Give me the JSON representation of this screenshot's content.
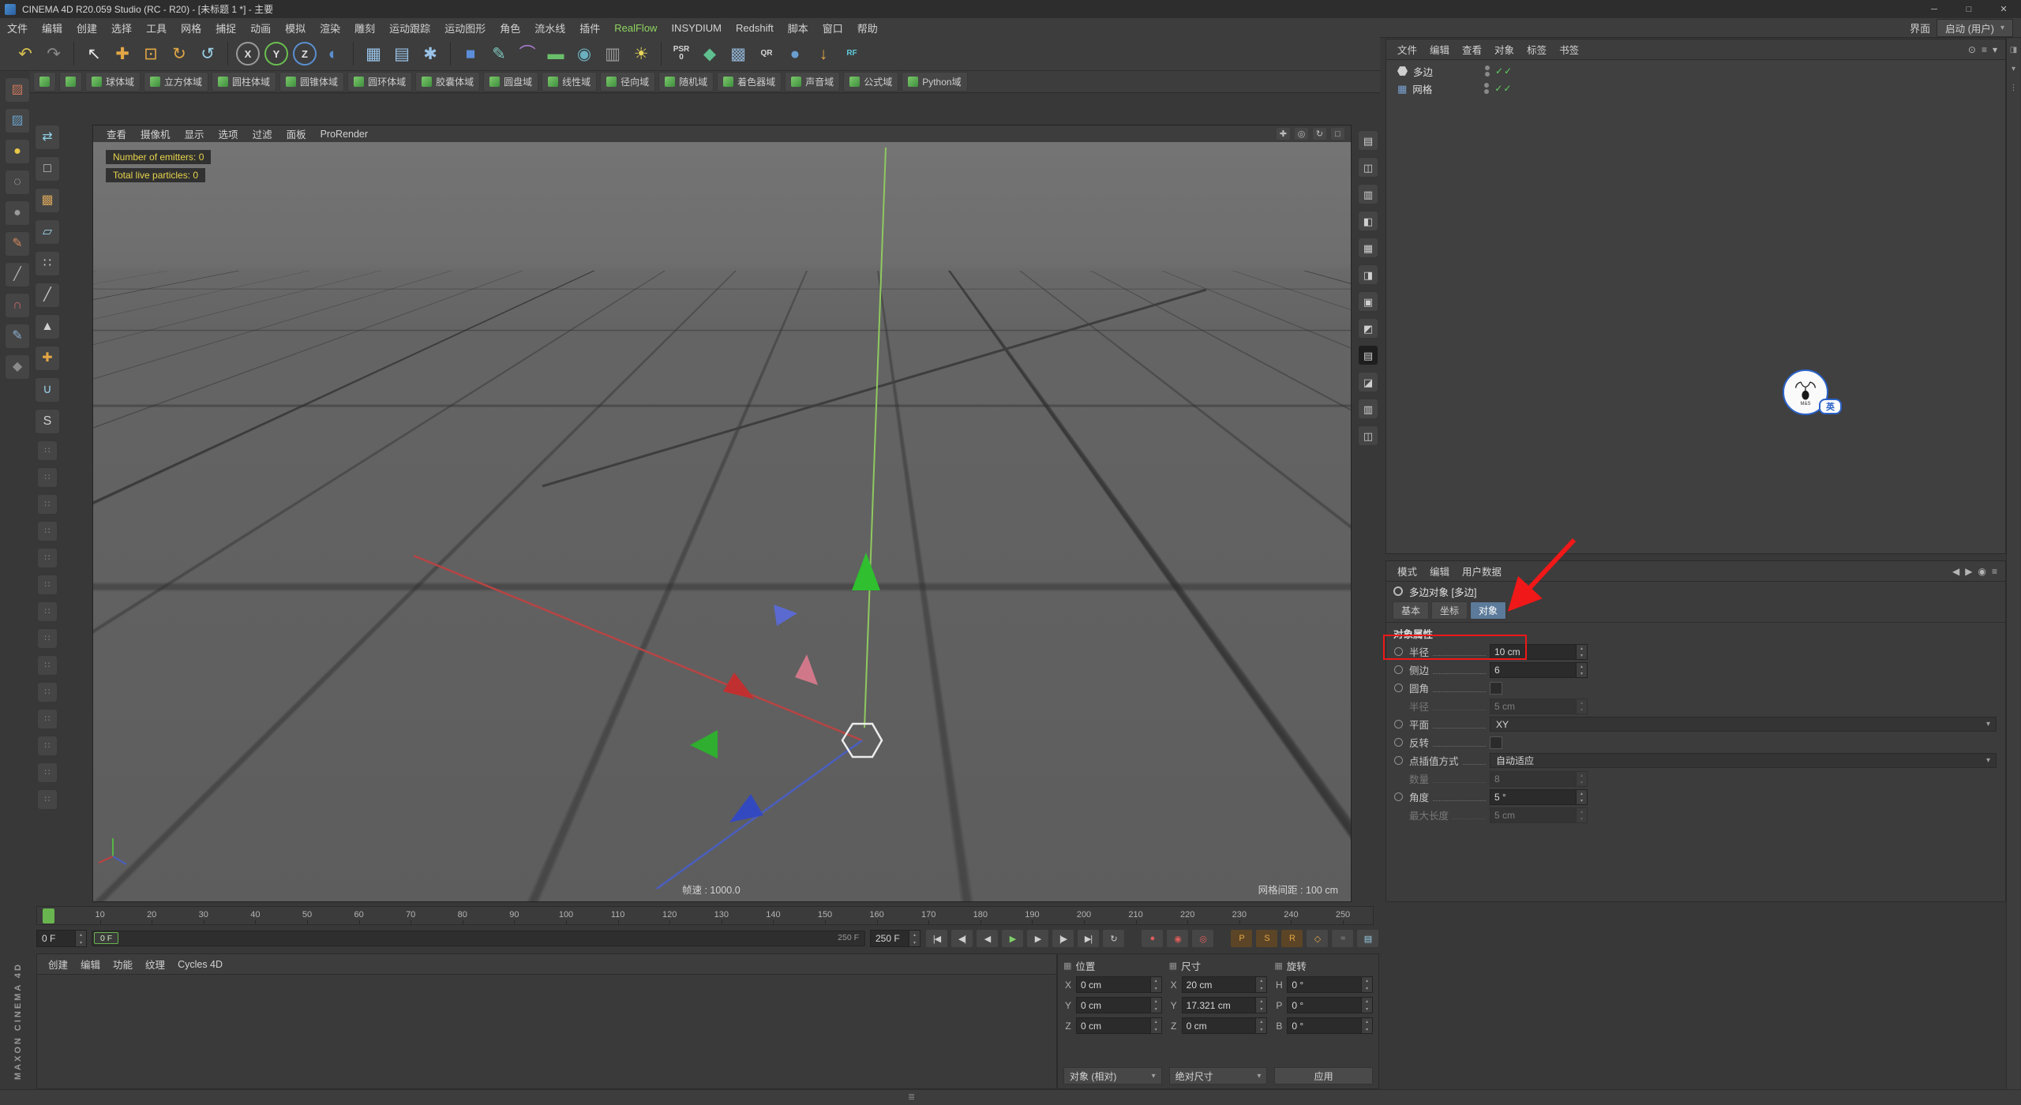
{
  "window": {
    "title": "CINEMA 4D R20.059 Studio (RC - R20) - [未标题 1 *] - 主要",
    "controls": {
      "minimize": "─",
      "maximize": "□",
      "close": "✕"
    }
  },
  "colors": {
    "realflow_green": "#8fd460",
    "play_green": "#7ed069",
    "record_red": "#e05c5c",
    "toggle_orange": "#e2a645",
    "annotation_red": "#f01818",
    "check_green": "#5fcf5f",
    "marker_green": "#69b54f",
    "hud_yellow": "#e8d44d",
    "axis_x_red": "#b84444",
    "axis_y_green": "#58b548",
    "axis_z_blue": "#4a5fc0",
    "tab_active_blue": "#5c7a99"
  },
  "ui": {
    "stepper_up": "▴",
    "stepper_down": "▾",
    "caret": "▾",
    "check": "✓",
    "grip": "≣"
  },
  "menu_bar": {
    "items": [
      "文件",
      "编辑",
      "创建",
      "选择",
      "工具",
      "网格",
      "捕捉",
      "动画",
      "模拟",
      "渲染",
      "雕刻",
      "运动跟踪",
      "运动图形",
      "角色",
      "流水线",
      "插件",
      "RealFlow",
      "INSYDIUM",
      "Redshift",
      "脚本",
      "窗口",
      "帮助"
    ],
    "right_label": "界面",
    "layout_selector": "启动 (用户)"
  },
  "toolbar": {
    "icons": [
      {
        "name": "undo-icon",
        "glyph": "↶",
        "color": "#d8c050"
      },
      {
        "name": "redo-icon",
        "glyph": "↷",
        "color": "#8a8a8a"
      },
      {
        "name": "sep"
      },
      {
        "name": "live-selection-icon",
        "glyph": "↖",
        "color": "#e8e8e8"
      },
      {
        "name": "move-tool-icon",
        "glyph": "✚",
        "color": "#e2a645"
      },
      {
        "name": "scale-tool-icon",
        "glyph": "⊡",
        "color": "#e2a645"
      },
      {
        "name": "rotate-tool-icon",
        "glyph": "↻",
        "color": "#e2a645"
      },
      {
        "name": "last-tool-icon",
        "glyph": "↺",
        "color": "#9ad0e8"
      },
      {
        "name": "sep"
      },
      {
        "name": "lock-x-axis-icon",
        "glyph": "X",
        "ring": "#9a9a9a"
      },
      {
        "name": "lock-y-axis-icon",
        "glyph": "Y",
        "ring": "#6abf4f"
      },
      {
        "name": "lock-z-axis-icon",
        "glyph": "Z",
        "ring": "#5a8fd0"
      },
      {
        "name": "coordinate-system-icon",
        "glyph": "◐",
        "color": "#5a8fd0"
      },
      {
        "name": "sep"
      },
      {
        "name": "render-view-icon",
        "glyph": "▦",
        "color": "#9ac4e8"
      },
      {
        "name": "render-picture-viewer-icon",
        "glyph": "▤",
        "color": "#9ac4e8"
      },
      {
        "name": "render-settings-icon",
        "glyph": "✱",
        "color": "#9ac4e8"
      },
      {
        "name": "sep"
      },
      {
        "name": "primitive-cube-icon",
        "glyph": "■",
        "color": "#5b8dd9"
      },
      {
        "name": "spline-pen-icon",
        "glyph": "✎",
        "color": "#7fc9c0"
      },
      {
        "name": "deformer-icon",
        "glyph": "⌒",
        "color": "#b07fd9"
      },
      {
        "name": "floor-icon",
        "glyph": "▬",
        "color": "#6abf6a"
      },
      {
        "name": "camera-icon",
        "glyph": "◉",
        "color": "#6ab0bf"
      },
      {
        "name": "display-icon",
        "glyph": "▥",
        "color": "#9a9a9a"
      },
      {
        "name": "light-icon",
        "glyph": "☀",
        "color": "#e8d45a"
      },
      {
        "name": "sep"
      },
      {
        "name": "psr-badge",
        "glyph": "PSR\n0",
        "color": "#d8d8d8",
        "text": true
      },
      {
        "name": "mograph-icon",
        "glyph": "◆",
        "color": "#5fbf8f"
      },
      {
        "name": "volume-icon",
        "glyph": "▩",
        "color": "#8fb0d0"
      },
      {
        "name": "qr-badge",
        "glyph": "QR",
        "color": "#d8d8d8",
        "text": true
      },
      {
        "name": "sky-icon",
        "glyph": "●",
        "color": "#6a9fd0"
      },
      {
        "name": "download-icon",
        "glyph": "↓",
        "color": "#e2a645"
      },
      {
        "name": "realflow-icon",
        "glyph": "RF",
        "color": "#5fc9d9",
        "text": true
      }
    ]
  },
  "fields_bar": {
    "buttons": [
      {
        "key": "group",
        "icon_only": true
      },
      {
        "key": "layer",
        "icon_only": true
      },
      {
        "key": "sphere",
        "label": "球体域"
      },
      {
        "key": "box",
        "label": "立方体域"
      },
      {
        "key": "cylinder",
        "label": "圆柱体域"
      },
      {
        "key": "cone",
        "label": "圆锥体域"
      },
      {
        "key": "torus",
        "label": "圆环体域"
      },
      {
        "key": "capsule",
        "label": "胶囊体域"
      },
      {
        "key": "disc",
        "label": "圆盘域"
      },
      {
        "key": "linear",
        "label": "线性域"
      },
      {
        "key": "radial",
        "label": "径向域"
      },
      {
        "key": "random",
        "label": "随机域"
      },
      {
        "key": "shader",
        "label": "着色器域"
      },
      {
        "key": "sound",
        "label": "声音域"
      },
      {
        "key": "formula",
        "label": "公式域"
      },
      {
        "key": "python",
        "label": "Python域"
      }
    ]
  },
  "left_dock_a": [
    {
      "name": "palette-image-icon-1",
      "glyph": "▨",
      "color": "#c7745a"
    },
    {
      "name": "palette-image-icon-2",
      "glyph": "▨",
      "color": "#6a9fc7"
    },
    {
      "name": "palette-sphere-yellow-icon",
      "glyph": "●",
      "color": "#e8c84a"
    },
    {
      "name": "palette-sphere-dotted-icon",
      "glyph": "◌",
      "color": "#c0c0c0"
    },
    {
      "name": "palette-sphere-gray-icon",
      "glyph": "●",
      "color": "#9a9a9a"
    },
    {
      "name": "palette-pencil-icon",
      "glyph": "✎",
      "color": "#d0885a"
    },
    {
      "name": "palette-knife-icon",
      "glyph": "╱",
      "color": "#b8b8b8"
    },
    {
      "name": "palette-magnet-icon",
      "glyph": "∩",
      "color": "#d06a6a"
    },
    {
      "name": "palette-brush-icon",
      "glyph": "✎",
      "color": "#8fb0d0"
    },
    {
      "name": "palette-misc-icon",
      "glyph": "◆",
      "color": "#8a8a8a"
    }
  ],
  "left_dock_b": [
    {
      "name": "make-editable-icon",
      "glyph": "⇄",
      "color": "#8fd0e8"
    },
    {
      "name": "model-mode-icon",
      "glyph": "□",
      "color": "#d0d0d0"
    },
    {
      "name": "texture-mode-icon",
      "glyph": "▩",
      "color": "#d0a05a"
    },
    {
      "name": "workplane-mode-icon",
      "glyph": "▱",
      "color": "#9ad0e8"
    },
    {
      "name": "points-mode-icon",
      "glyph": "∷",
      "color": "#d0d0d0"
    },
    {
      "name": "edges-mode-icon",
      "glyph": "╱",
      "color": "#d0d0d0"
    },
    {
      "name": "polygons-mode-icon",
      "glyph": "▲",
      "color": "#d0d0d0"
    },
    {
      "name": "enable-axis-icon",
      "glyph": "✚",
      "color": "#e2a645"
    },
    {
      "name": "snap-icon",
      "glyph": "∪",
      "color": "#9ad0e8"
    },
    {
      "name": "solo-icon",
      "glyph": "S",
      "color": "#d0d0d0"
    },
    {
      "name": "palette-slot-1",
      "glyph": "∷",
      "color": "#8a8a8a",
      "small": true
    },
    {
      "name": "palette-slot-2",
      "glyph": "∷",
      "color": "#8a8a8a",
      "small": true
    },
    {
      "name": "palette-slot-3",
      "glyph": "∷",
      "color": "#8a8a8a",
      "small": true
    },
    {
      "name": "palette-slot-4",
      "glyph": "∷",
      "color": "#8a8a8a",
      "small": true
    },
    {
      "name": "palette-slot-5",
      "glyph": "∷",
      "color": "#8a8a8a",
      "small": true
    },
    {
      "name": "palette-slot-6",
      "glyph": "∷",
      "color": "#8a8a8a",
      "small": true
    },
    {
      "name": "palette-slot-7",
      "glyph": "∷",
      "color": "#8a8a8a",
      "small": true
    },
    {
      "name": "palette-slot-8",
      "glyph": "∷",
      "color": "#8a8a8a",
      "small": true
    },
    {
      "name": "palette-slot-9",
      "glyph": "∷",
      "color": "#8a8a8a",
      "small": true
    },
    {
      "name": "palette-slot-10",
      "glyph": "∷",
      "color": "#8a8a8a",
      "small": true
    },
    {
      "name": "palette-slot-11",
      "glyph": "∷",
      "color": "#8a8a8a",
      "small": true
    },
    {
      "name": "palette-slot-12",
      "glyph": "∷",
      "color": "#8a8a8a",
      "small": true
    },
    {
      "name": "palette-slot-13",
      "glyph": "∷",
      "color": "#8a8a8a",
      "small": true
    },
    {
      "name": "palette-slot-14",
      "glyph": "∷",
      "color": "#8a8a8a",
      "small": true
    }
  ],
  "right_dock": [
    {
      "name": "right-dock-icon-1",
      "glyph": "▤"
    },
    {
      "name": "right-dock-icon-2",
      "glyph": "◫"
    },
    {
      "name": "right-dock-icon-3",
      "glyph": "▥"
    },
    {
      "name": "right-dock-icon-4",
      "glyph": "◧"
    },
    {
      "name": "right-dock-icon-5",
      "glyph": "▦"
    },
    {
      "name": "right-dock-icon-6",
      "glyph": "◨"
    },
    {
      "name": "right-dock-icon-7",
      "glyph": "▣"
    },
    {
      "name": "right-dock-icon-8",
      "glyph": "◩"
    },
    {
      "name": "right-dock-icon-9",
      "glyph": "▤",
      "dark": true
    },
    {
      "name": "right-dock-icon-10",
      "glyph": "◪"
    },
    {
      "name": "right-dock-icon-11",
      "glyph": "▥"
    },
    {
      "name": "right-dock-icon-12",
      "glyph": "◫"
    }
  ],
  "right_edge": [
    {
      "name": "edge-tab-icon-1",
      "glyph": "◨"
    },
    {
      "name": "edge-tab-icon-2",
      "glyph": "▾"
    },
    {
      "name": "edge-grip-icon",
      "glyph": "⋮"
    }
  ],
  "viewport": {
    "menus": [
      "查看",
      "摄像机",
      "显示",
      "选项",
      "过滤",
      "面板",
      "ProRender"
    ],
    "corner_icons": [
      {
        "name": "pan-view-icon",
        "glyph": "✚"
      },
      {
        "name": "zoom-view-icon",
        "glyph": "◎"
      },
      {
        "name": "orbit-view-icon",
        "glyph": "↻"
      },
      {
        "name": "maximize-view-icon",
        "glyph": "□"
      }
    ],
    "hud_line1": "Number of emitters: 0",
    "hud_line2": "Total live particles: 0",
    "frame_rate_label": "帧速 : 1000.0",
    "grid_spacing_label": "网格间距 : 100 cm"
  },
  "timeline": {
    "min": 0,
    "max": 250,
    "label_step": 10,
    "start_frame": "0 F",
    "end_frame": "250 F",
    "current_frame": "0 F",
    "range_max_label": "250 F"
  },
  "transport": [
    {
      "name": "goto-start-button",
      "glyph": "|◀"
    },
    {
      "name": "goto-prev-key-button",
      "glyph": "◀|"
    },
    {
      "name": "prev-frame-button",
      "glyph": "◀"
    },
    {
      "name": "play-button",
      "glyph": "▶",
      "colorKey": "play_green"
    },
    {
      "name": "next-frame-button",
      "glyph": "▶"
    },
    {
      "name": "goto-next-key-button",
      "glyph": "|▶"
    },
    {
      "name": "goto-end-button",
      "glyph": "▶|"
    },
    {
      "name": "loop-playback-button",
      "glyph": "↻"
    },
    {
      "name": "gap"
    },
    {
      "name": "record-objects-button",
      "glyph": "●",
      "colorKey": "record_red"
    },
    {
      "name": "autokey-button",
      "glyph": "◉",
      "colorKey": "record_red"
    },
    {
      "name": "keyframe-selection-button",
      "glyph": "◎",
      "colorKey": "record_red"
    },
    {
      "name": "gap"
    },
    {
      "name": "record-position-toggle",
      "glyph": "P",
      "colorKey": "toggle_orange",
      "active": true
    },
    {
      "name": "record-scale-toggle",
      "glyph": "S",
      "colorKey": "toggle_orange",
      "active": true
    },
    {
      "name": "record-rotation-toggle",
      "glyph": "R",
      "colorKey": "toggle_orange",
      "active": true
    },
    {
      "name": "record-parameter-toggle",
      "glyph": "◇",
      "colorKey": "toggle_orange"
    },
    {
      "name": "record-pla-toggle",
      "glyph": "≈",
      "color": "#9a9a9a"
    },
    {
      "name": "playback-options-button",
      "glyph": "▤",
      "color": "#9ad0e8"
    }
  ],
  "material_manager": {
    "menus": [
      "创建",
      "编辑",
      "功能",
      "纹理",
      "Cycles 4D"
    ]
  },
  "coordinates": {
    "columns": [
      {
        "header": "位置",
        "rows": [
          {
            "axis": "X",
            "value": "0 cm"
          },
          {
            "axis": "Y",
            "value": "0 cm"
          },
          {
            "axis": "Z",
            "value": "0 cm"
          }
        ],
        "footer": {
          "type": "select",
          "label": "对象 (相对)"
        }
      },
      {
        "header": "尺寸",
        "rows": [
          {
            "axis": "X",
            "value": "20 cm"
          },
          {
            "axis": "Y",
            "value": "17.321 cm"
          },
          {
            "axis": "Z",
            "value": "0 cm"
          }
        ],
        "footer": {
          "type": "select",
          "label": "绝对尺寸"
        }
      },
      {
        "header": "旋转",
        "rows": [
          {
            "axis": "H",
            "value": "0 °"
          },
          {
            "axis": "P",
            "value": "0 °"
          },
          {
            "axis": "B",
            "value": "0 °"
          }
        ],
        "footer": {
          "type": "button",
          "label": "应用"
        }
      }
    ]
  },
  "object_manager": {
    "menus": [
      "文件",
      "编辑",
      "查看",
      "对象",
      "标签",
      "书签"
    ],
    "icons": [
      {
        "name": "om-search-icon",
        "glyph": "⊙"
      },
      {
        "name": "om-filter-icon",
        "glyph": "≡"
      },
      {
        "name": "om-path-icon",
        "glyph": "▾"
      }
    ],
    "objects": [
      {
        "name": "多边",
        "icon": "nside-spline-icon"
      },
      {
        "name": "网格",
        "icon": "mesh-icon"
      }
    ]
  },
  "attributes": {
    "menus": [
      "模式",
      "编辑",
      "用户数据"
    ],
    "icons": [
      {
        "name": "am-history-back-icon",
        "glyph": "◀"
      },
      {
        "name": "am-history-fwd-icon",
        "glyph": "▶"
      },
      {
        "name": "am-lock-icon",
        "glyph": "◉"
      },
      {
        "name": "am-config-icon",
        "glyph": "≡"
      }
    ],
    "title": "多边对象 [多边]",
    "tabs": [
      {
        "label": "基本",
        "active": false
      },
      {
        "label": "坐标",
        "active": false
      },
      {
        "label": "对象",
        "active": true
      }
    ],
    "section": "对象属性",
    "rows": [
      {
        "key": "radius",
        "label": "半径",
        "type": "number",
        "value": "10 cm",
        "enabled": true
      },
      {
        "key": "sides",
        "label": "侧边",
        "type": "number",
        "value": "6",
        "enabled": true
      },
      {
        "key": "rounding",
        "label": "圆角",
        "type": "checkbox",
        "checked": false,
        "enabled": true
      },
      {
        "key": "rounding-radius",
        "label": "半径",
        "type": "number",
        "value": "5 cm",
        "enabled": false
      },
      {
        "key": "plane",
        "label": "平面",
        "type": "select",
        "value": "XY",
        "enabled": true
      },
      {
        "key": "reverse",
        "label": "反转",
        "type": "checkbox",
        "checked": false,
        "enabled": true
      },
      {
        "key": "intermediate-points",
        "label": "点插值方式",
        "type": "select",
        "value": "自动适应",
        "enabled": true
      },
      {
        "key": "number",
        "label": "数量",
        "type": "number",
        "value": "8",
        "enabled": false
      },
      {
        "key": "angle",
        "label": "角度",
        "type": "number",
        "value": "5 °",
        "enabled": true
      },
      {
        "key": "maximum-length",
        "label": "最大长度",
        "type": "number",
        "value": "5 cm",
        "enabled": false
      }
    ]
  },
  "annotation": {
    "box_target": "radius"
  },
  "watermark": {
    "badge": "英",
    "sub": "M&S"
  },
  "branding": "MAXON CINEMA 4D"
}
